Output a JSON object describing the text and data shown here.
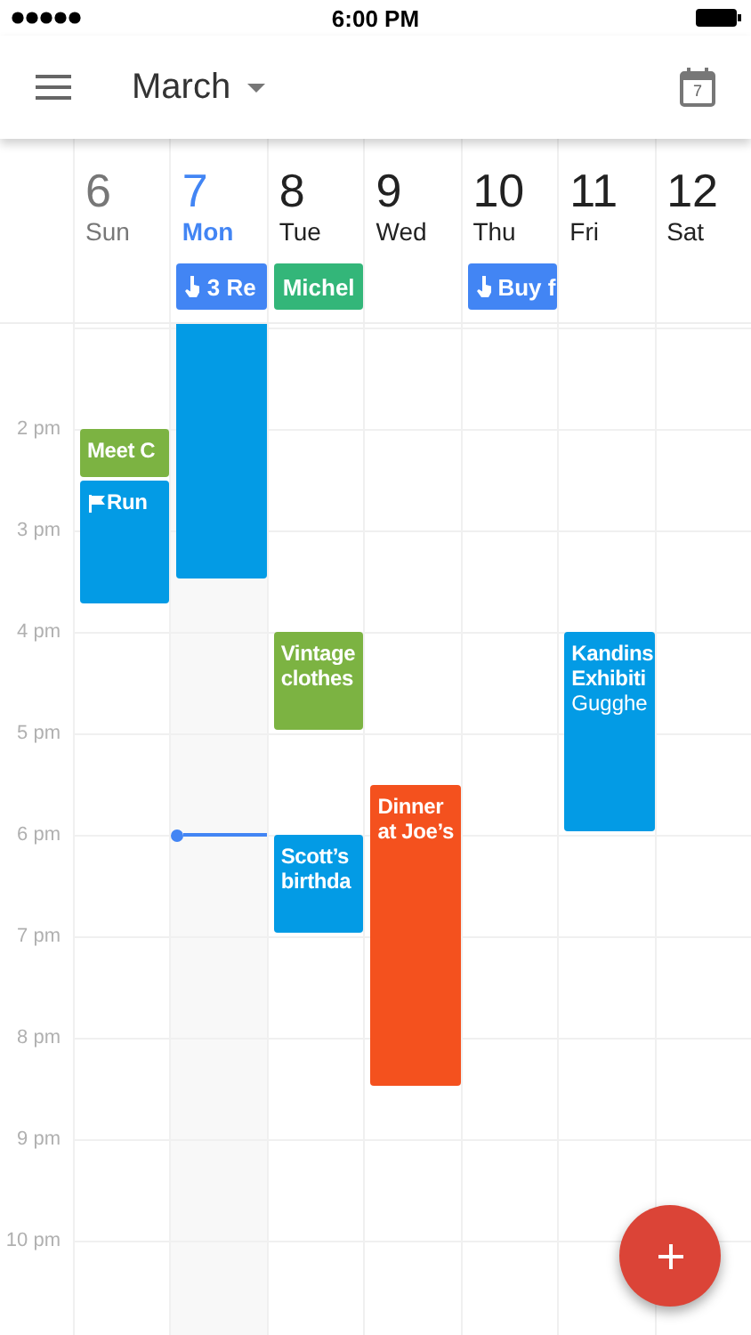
{
  "status_bar": {
    "time": "6:00 PM"
  },
  "app_bar": {
    "title": "March",
    "today_icon_label": "7"
  },
  "hours": [
    "2 pm",
    "3 pm",
    "4 pm",
    "5 pm",
    "6 pm",
    "7 pm",
    "8 pm",
    "9 pm",
    "10 pm"
  ],
  "days": [
    {
      "date": "6",
      "weekday": "Sun",
      "today": false,
      "past": true,
      "events": [
        {
          "kind": "event",
          "title": "Meet C",
          "color": "#7cb342"
        },
        {
          "kind": "goal",
          "title": "Run",
          "color": "#039be5"
        }
      ]
    },
    {
      "date": "7",
      "weekday": "Mon",
      "today": true,
      "past": false,
      "all_day": [
        {
          "kind": "reminder",
          "title": "3 Re",
          "color": "#4285f4"
        }
      ],
      "events": [
        {
          "kind": "event",
          "color": "#039be5"
        }
      ]
    },
    {
      "date": "8",
      "weekday": "Tue",
      "today": false,
      "past": false,
      "all_day": [
        {
          "kind": "event",
          "title": "Michel",
          "color": "#33b679"
        }
      ],
      "events": [
        {
          "kind": "event",
          "title": "Vintage clothes",
          "color": "#7cb342"
        },
        {
          "kind": "event",
          "title": "Scott’s birthda",
          "color": "#039be5"
        }
      ]
    },
    {
      "date": "9",
      "weekday": "Wed",
      "today": false,
      "past": false,
      "events": [
        {
          "kind": "event",
          "title": "Dinner at Joe’s",
          "color": "#f4511e"
        }
      ]
    },
    {
      "date": "10",
      "weekday": "Thu",
      "today": false,
      "past": false,
      "all_day": [
        {
          "kind": "reminder",
          "title": "Buy f",
          "color": "#4285f4"
        }
      ]
    },
    {
      "date": "11",
      "weekday": "Fri",
      "today": false,
      "past": false,
      "events": [
        {
          "kind": "event",
          "title": "Kandins Exhibiti",
          "subtitle": "Gugghe",
          "color": "#039be5"
        }
      ]
    },
    {
      "date": "12",
      "weekday": "Sat",
      "today": false,
      "past": false
    }
  ]
}
